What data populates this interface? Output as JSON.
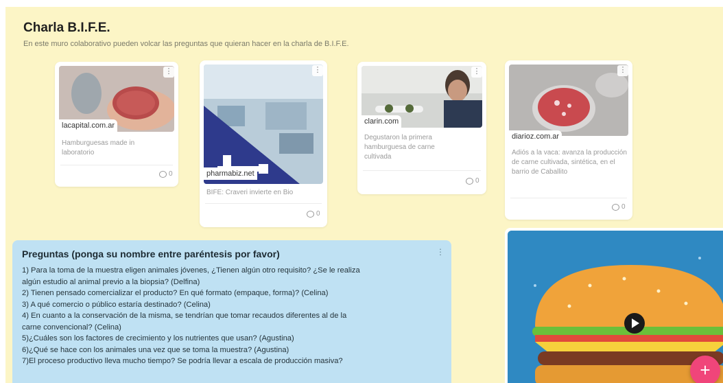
{
  "board": {
    "title": "Charla B.I.F.E.",
    "description": "En este muro colaborativo pueden volcar las preguntas que quieran hacer en la charla de B.I.F.E."
  },
  "cards": [
    {
      "domain": "lacapital.com.ar",
      "caption": "Hamburguesas made in laboratorio",
      "comments": "0",
      "image_icon": "lab-burger-image"
    },
    {
      "domain": "pharmabiz.net",
      "caption": "BIFE: Craveri invierte en Bio",
      "comments": "0",
      "image_icon": "laboratory-image"
    },
    {
      "domain": "clarin.com",
      "caption": "Degustaron la primera hamburguesa de carne cultivada",
      "comments": "0",
      "image_icon": "scientist-image"
    },
    {
      "domain": "diarioz.com.ar",
      "caption": "Adiós a la vaca: avanza la producción de carne cultivada, sintética, en el barrio de Caballito",
      "comments": "0",
      "image_icon": "petri-dish-image"
    }
  ],
  "questions": {
    "title": "Preguntas (ponga su nombre entre paréntesis por favor)",
    "lines": [
      "1) Para la toma de la muestra eligen animales jóvenes, ¿Tienen algún otro requisito? ¿Se le realiza",
      "algún estudio al animal previo a la biopsia? (Delfina)",
      "2) Tienen pensado comercializar el producto? En qué formato (empaque, forma)? (Celina)",
      "3) A qué comercio o público estaría destinado? (Celina)",
      "4) En cuanto a la conservación de la misma, se tendrían que tomar recaudos diferentes al de la",
      "carne convencional? (Celina)",
      "5)¿Cuáles son los factores de crecimiento y los nutrientes que usan? (Agustina)",
      "6)¿Qué se hace con los animales una vez que se toma la muestra? (Agustina)",
      "7)El proceso productivo lleva mucho tiempo? Se podría llevar a escala de producción masiva?"
    ]
  },
  "video": {
    "icon": "play-icon"
  },
  "fab": {
    "label": "+"
  },
  "colors": {
    "board": "#fcf5c6",
    "questions": "#bfe1f3",
    "fab": "#f0457a"
  }
}
